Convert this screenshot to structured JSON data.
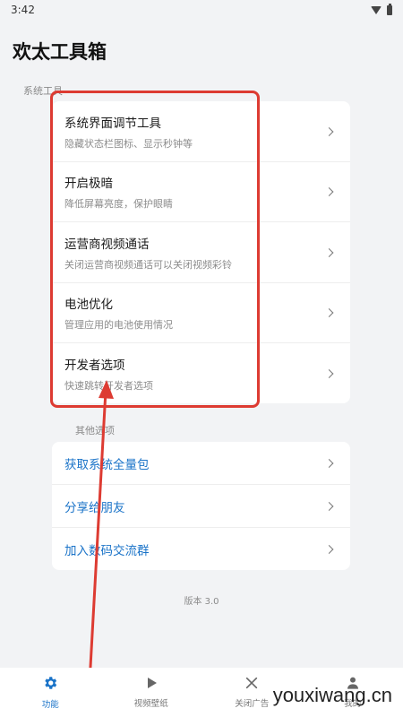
{
  "status_bar": {
    "time": "3:42"
  },
  "page": {
    "title": "欢太工具箱"
  },
  "system_tools": {
    "section_label": "系统工具",
    "items": [
      {
        "title": "系统界面调节工具",
        "subtitle": "隐藏状态栏图标、显示秒钟等"
      },
      {
        "title": "开启极暗",
        "subtitle": "降低屏幕亮度，保护眼睛"
      },
      {
        "title": "运营商视频通话",
        "subtitle": "关闭运营商视频通话可以关闭视频彩铃"
      },
      {
        "title": "电池优化",
        "subtitle": "管理应用的电池使用情况"
      },
      {
        "title": "开发者选项",
        "subtitle": "快速跳转开发者选项"
      }
    ]
  },
  "other_options": {
    "section_label": "其他选项",
    "items": [
      {
        "title": "获取系统全量包"
      },
      {
        "title": "分享给朋友"
      },
      {
        "title": "加入数码交流群"
      }
    ]
  },
  "version": "版本 3.0",
  "bottom_nav": {
    "items": [
      {
        "label": "功能",
        "icon": "gear-icon",
        "active": true
      },
      {
        "label": "视频壁纸",
        "icon": "play-icon",
        "active": false
      },
      {
        "label": "关闭广告",
        "icon": "close-icon",
        "active": false
      },
      {
        "label": "我的",
        "icon": "person-icon",
        "active": false
      }
    ]
  },
  "watermark": "youxiwang.cn",
  "colors": {
    "accent": "#1a73c8",
    "highlight": "#dd3b32",
    "background": "#f2f3f5"
  }
}
